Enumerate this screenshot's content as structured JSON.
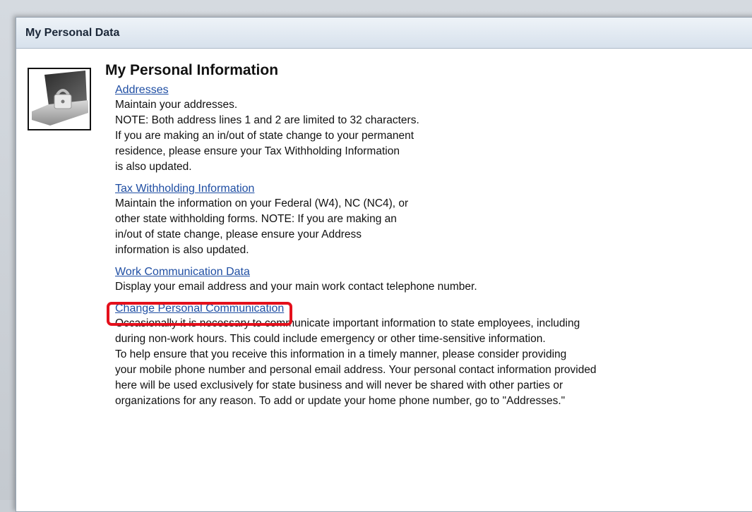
{
  "panel": {
    "title": "My Personal Data"
  },
  "section": {
    "title": "My Personal Information",
    "image": "laptop-with-padlock-image"
  },
  "items": [
    {
      "link": "Addresses",
      "lines": [
        "Maintain your addresses.",
        "NOTE:  Both address lines 1 and 2 are limited to 32 characters.",
        "If you are making an in/out of state change to your permanent",
        "residence, please ensure your Tax Withholding Information",
        "is also updated."
      ]
    },
    {
      "link": "Tax Withholding Information",
      "lines": [
        "Maintain the information on your Federal (W4), NC (NC4), or",
        "other state withholding forms.  NOTE: If you are making an",
        "in/out of state change, please ensure your Address",
        "information is also updated."
      ]
    },
    {
      "link": "Work Communication Data",
      "highlighted": true,
      "lines": [
        "Display your email address and your main work contact telephone number."
      ]
    },
    {
      "link": "Change Personal Communication",
      "lines": [
        "Occasionally it is necessary to communicate important information to state employees, including",
        "during non-work hours.  This could include emergency or other time-sensitive information.",
        "To help ensure that you receive this information in a timely manner, please consider providing",
        "your mobile phone number and personal email address.  Your personal contact information provided",
        "here will be used exclusively for state business and will never be shared with other parties or",
        "organizations for any reason.  To add or update your home phone number, go to \"Addresses.\""
      ]
    }
  ],
  "colors": {
    "link": "#1f4ea3",
    "highlight": "#e4101c",
    "header_bg": "#dde6f0"
  }
}
